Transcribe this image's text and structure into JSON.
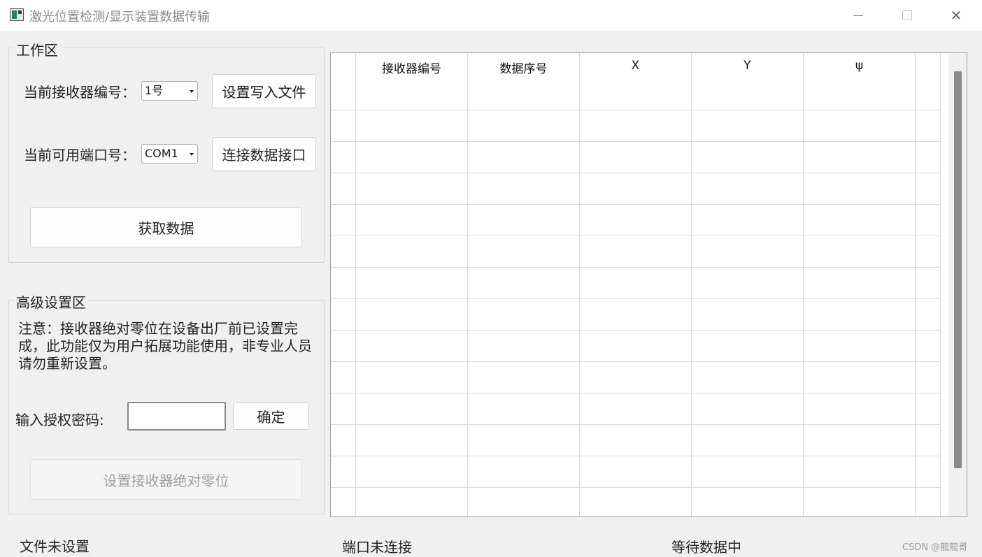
{
  "window": {
    "title": "激光位置检测/显示装置数据传输",
    "minimize": "─",
    "maximize": "□",
    "close": "✕"
  },
  "work_area": {
    "title": "工作区",
    "receiver_label": "当前接收器编号：",
    "receiver_value": "1号",
    "set_file_button": "设置写入文件",
    "port_label": "当前可用端口号：",
    "port_value": "COM1",
    "connect_button": "连接数据接口",
    "fetch_button": "获取数据"
  },
  "advanced": {
    "title": "高级设置区",
    "note": "注意：接收器绝对零位在设备出厂前已设置完成，此功能仅为用户拓展功能使用，非专业人员请勿重新设置。",
    "password_label": "输入授权密码:",
    "password_value": "",
    "confirm_button": "确定",
    "set_zero_button": "设置接收器绝对零位"
  },
  "table": {
    "columns": [
      "",
      "接收器编号",
      "数据序号",
      "X",
      "Y",
      "ψ",
      ""
    ],
    "row_count": 13
  },
  "status": {
    "file": "文件未设置",
    "port": "端口未连接",
    "data": "等待数据中"
  },
  "watermark": "CSDN @龍龍哥"
}
